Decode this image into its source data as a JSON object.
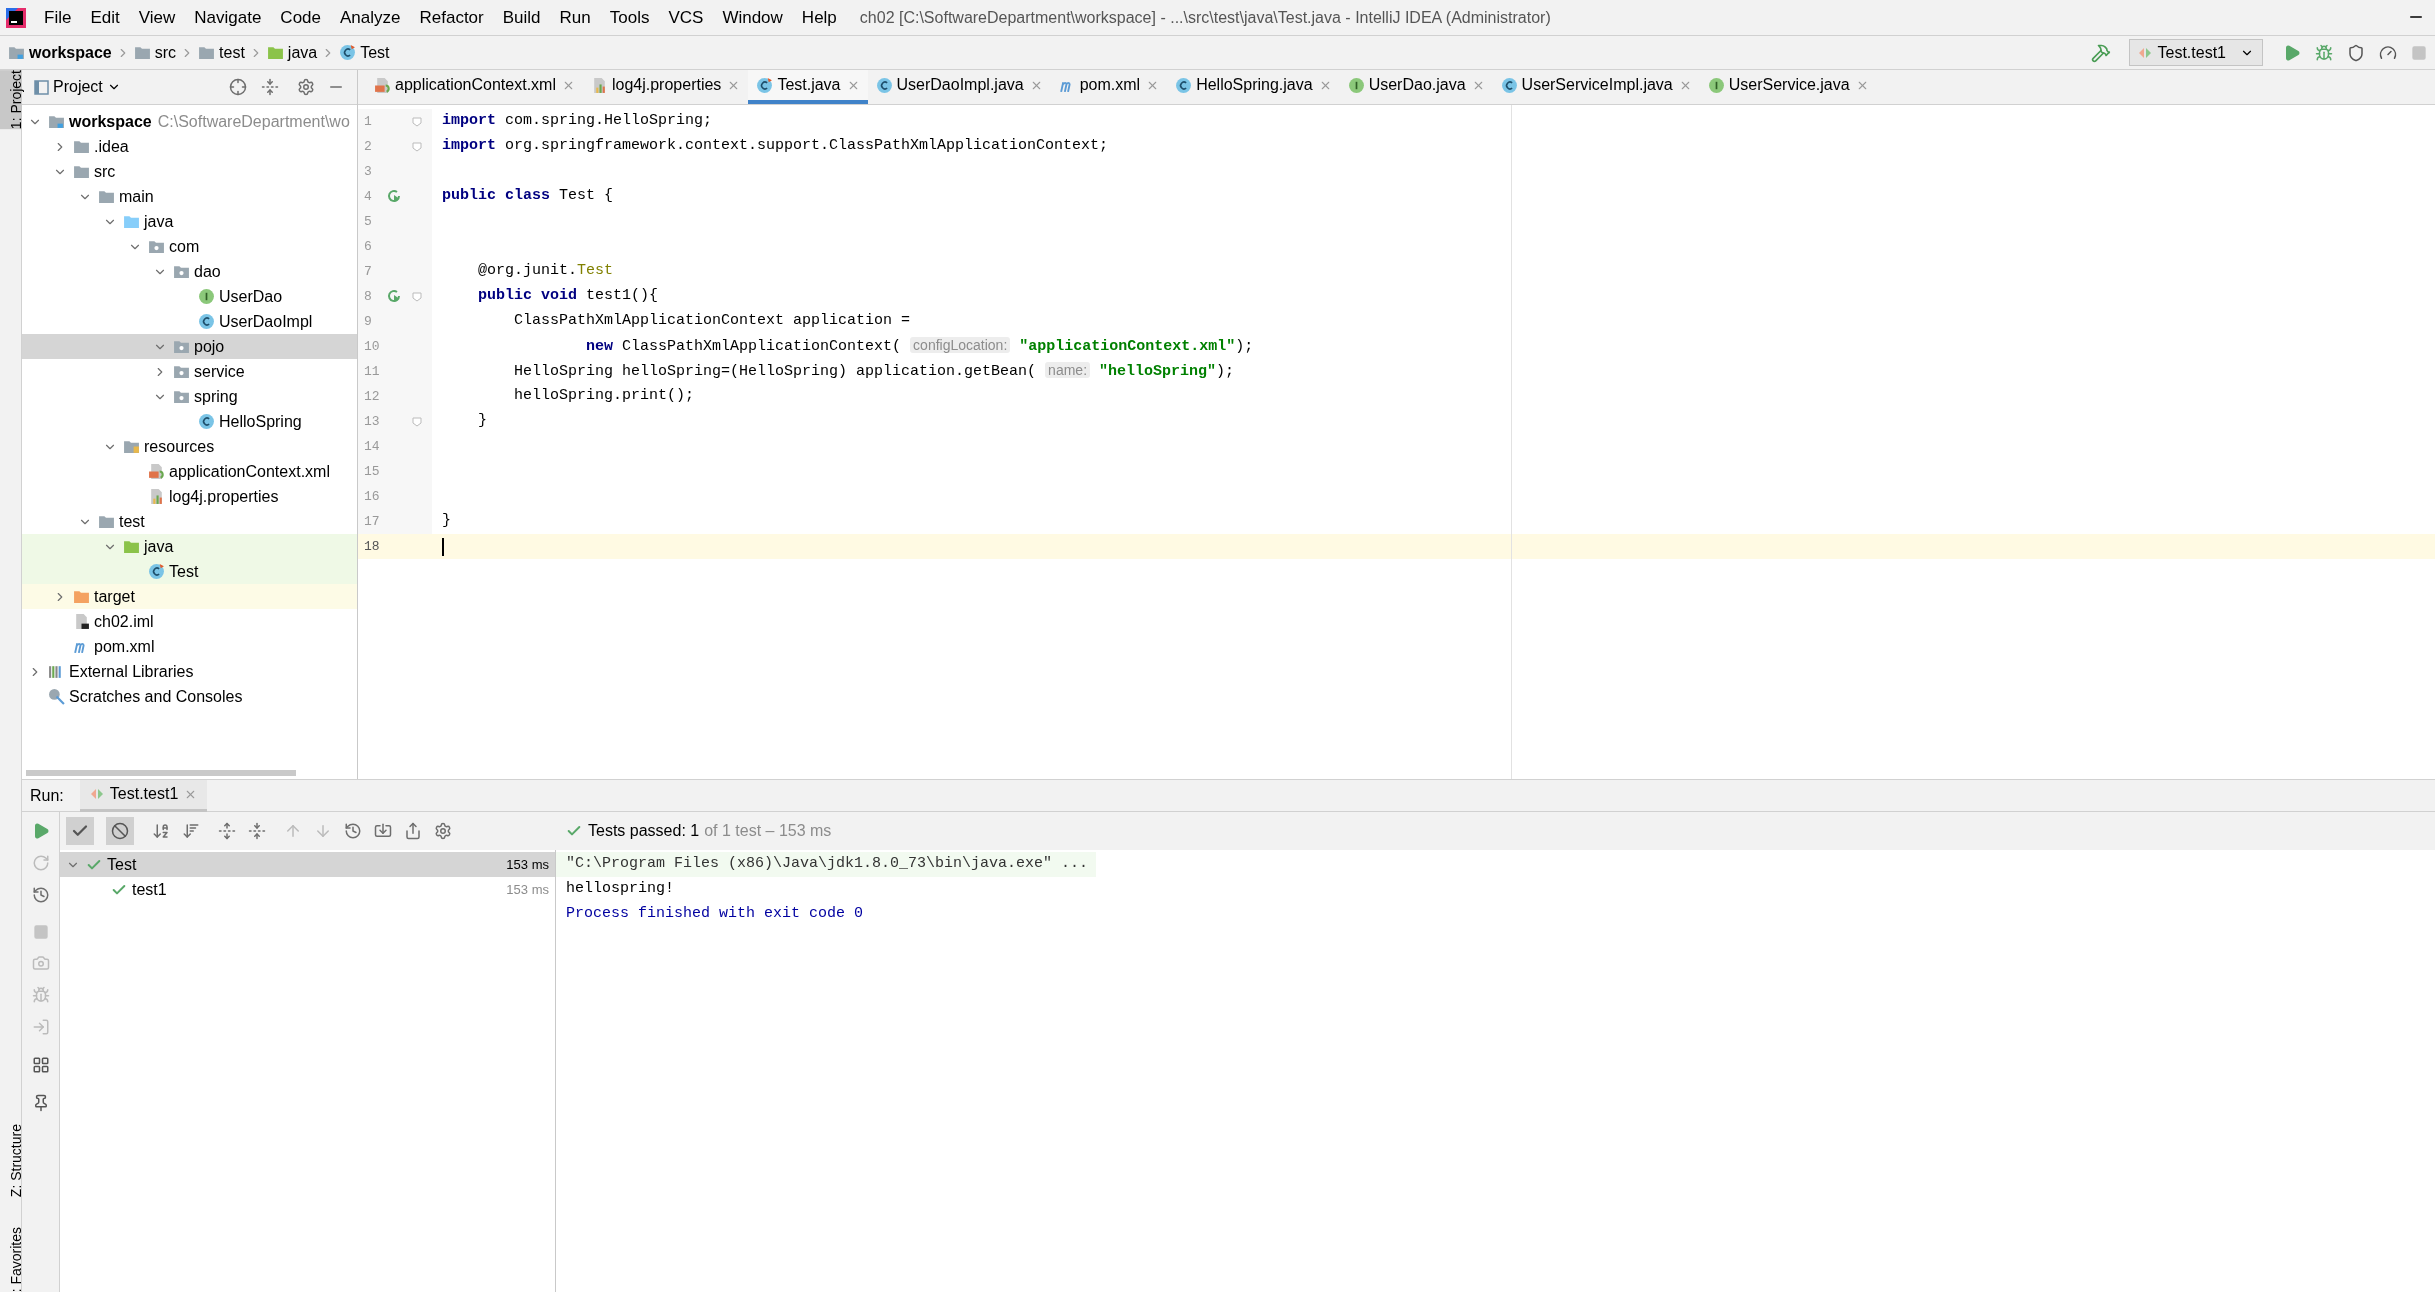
{
  "menu": [
    "File",
    "Edit",
    "View",
    "Navigate",
    "Code",
    "Analyze",
    "Refactor",
    "Build",
    "Run",
    "Tools",
    "VCS",
    "Window",
    "Help"
  ],
  "window": {
    "title": "ch02 [C:\\SoftwareDepartment\\workspace] - ...\\src\\test\\java\\Test.java - IntelliJ IDEA (Administrator)"
  },
  "breadcrumbs": [
    {
      "label": "workspace",
      "kind": "module"
    },
    {
      "label": "src",
      "kind": "folder"
    },
    {
      "label": "test",
      "kind": "folder"
    },
    {
      "label": "java",
      "kind": "test-folder"
    },
    {
      "label": "Test",
      "kind": "test-class"
    }
  ],
  "run_config": "Test.test1",
  "side_stripe": [
    {
      "label": "1: Project",
      "selected": true
    },
    {
      "label": "Z: Structure",
      "selected": false
    },
    {
      "label": ": Favorites",
      "selected": false
    }
  ],
  "project_panel": {
    "title": "Project",
    "tree": [
      {
        "label": "workspace",
        "path": "C:\\SoftwareDepartment\\wo",
        "kind": "module",
        "expanded": true,
        "selected": false,
        "children": [
          {
            "label": ".idea",
            "kind": "folder",
            "expanded": false,
            "selected": false
          },
          {
            "label": "src",
            "kind": "folder",
            "expanded": true,
            "selected": false,
            "children": [
              {
                "label": "main",
                "kind": "folder",
                "expanded": true,
                "selected": false,
                "children": [
                  {
                    "label": "java",
                    "kind": "source-folder",
                    "expanded": true,
                    "selected": false,
                    "children": [
                      {
                        "label": "com",
                        "kind": "package",
                        "expanded": true,
                        "selected": false,
                        "children": [
                          {
                            "label": "dao",
                            "kind": "package",
                            "expanded": true,
                            "selected": false,
                            "children": [
                              {
                                "label": "UserDao",
                                "kind": "interface",
                                "selected": false
                              },
                              {
                                "label": "UserDaoImpl",
                                "kind": "class",
                                "selected": false
                              }
                            ]
                          },
                          {
                            "label": "pojo",
                            "kind": "package",
                            "expanded": true,
                            "selected": true
                          },
                          {
                            "label": "service",
                            "kind": "package",
                            "expanded": false,
                            "selected": false
                          },
                          {
                            "label": "spring",
                            "kind": "package",
                            "expanded": true,
                            "selected": false,
                            "children": [
                              {
                                "label": "HelloSpring",
                                "kind": "class",
                                "selected": false
                              }
                            ]
                          }
                        ]
                      }
                    ]
                  },
                  {
                    "label": "resources",
                    "kind": "resources-folder",
                    "expanded": true,
                    "selected": false,
                    "children": [
                      {
                        "label": "applicationContext.xml",
                        "kind": "xml",
                        "selected": false
                      },
                      {
                        "label": "log4j.properties",
                        "kind": "properties",
                        "selected": false
                      }
                    ]
                  }
                ]
              },
              {
                "label": "test",
                "kind": "folder",
                "expanded": true,
                "selected": false,
                "children": [
                  {
                    "label": "java",
                    "kind": "test-folder",
                    "expanded": true,
                    "selected": false,
                    "children": [
                      {
                        "label": "Test",
                        "kind": "test-class",
                        "selected": false
                      }
                    ]
                  }
                ]
              }
            ]
          },
          {
            "label": "target",
            "kind": "excluded-folder",
            "expanded": false,
            "selected": false
          },
          {
            "label": "ch02.iml",
            "kind": "iml",
            "selected": false
          },
          {
            "label": "pom.xml",
            "kind": "maven",
            "selected": false
          }
        ]
      },
      {
        "label": "External Libraries",
        "kind": "libraries",
        "expanded": false,
        "selected": false
      },
      {
        "label": "Scratches and Consoles",
        "kind": "scratches",
        "selected": false
      }
    ]
  },
  "editor": {
    "tabs": [
      {
        "label": "applicationContext.xml",
        "kind": "xml",
        "selected": false
      },
      {
        "label": "log4j.properties",
        "kind": "properties",
        "selected": false
      },
      {
        "label": "Test.java",
        "kind": "test-class",
        "selected": true
      },
      {
        "label": "UserDaoImpl.java",
        "kind": "class",
        "selected": false
      },
      {
        "label": "pom.xml",
        "kind": "maven",
        "selected": false
      },
      {
        "label": "HelloSpring.java",
        "kind": "class",
        "selected": false
      },
      {
        "label": "UserDao.java",
        "kind": "interface",
        "selected": false
      },
      {
        "label": "UserServiceImpl.java",
        "kind": "class",
        "selected": false
      },
      {
        "label": "UserService.java",
        "kind": "interface",
        "selected": false
      }
    ],
    "lines": [
      {
        "number": "1",
        "run_marker": false,
        "fold_marker": true,
        "current": false,
        "tokens": [
          {
            "kind": "kw",
            "text": "import"
          },
          {
            "kind": "plain",
            "text": " com.spring.HelloSpring;"
          }
        ]
      },
      {
        "number": "2",
        "run_marker": false,
        "fold_marker": true,
        "current": false,
        "tokens": [
          {
            "kind": "kw",
            "text": "import"
          },
          {
            "kind": "plain",
            "text": " org.springframework.context.support.ClassPathXmlApplicationContext;"
          }
        ]
      },
      {
        "number": "3",
        "run_marker": false,
        "fold_marker": false,
        "current": false
      },
      {
        "number": "4",
        "run_marker": true,
        "fold_marker": false,
        "current": false,
        "tokens": [
          {
            "kind": "kw",
            "text": "public class"
          },
          {
            "kind": "plain",
            "text": " Test {"
          }
        ]
      },
      {
        "number": "5",
        "run_marker": false,
        "fold_marker": false,
        "current": false
      },
      {
        "number": "6",
        "run_marker": false,
        "fold_marker": false,
        "current": false
      },
      {
        "number": "7",
        "run_marker": false,
        "fold_marker": false,
        "current": false,
        "tokens": [
          {
            "kind": "plain",
            "text": "    @org.junit."
          },
          {
            "kind": "ann",
            "text": "Test"
          }
        ]
      },
      {
        "number": "8",
        "run_marker": true,
        "fold_marker": true,
        "current": false,
        "tokens": [
          {
            "kind": "kw",
            "text": "    public void"
          },
          {
            "kind": "plain",
            "text": " test1(){"
          }
        ]
      },
      {
        "number": "9",
        "run_marker": false,
        "fold_marker": false,
        "current": false,
        "tokens": [
          {
            "kind": "plain",
            "text": "        ClassPathXmlApplicationContext application ="
          }
        ]
      },
      {
        "number": "10",
        "run_marker": false,
        "fold_marker": false,
        "current": false,
        "tokens": [
          {
            "kind": "kw",
            "text": "                new"
          },
          {
            "kind": "plain",
            "text": " ClassPathXmlApplicationContext( "
          },
          {
            "kind": "hint",
            "text": "configLocation:"
          },
          {
            "kind": "str",
            "text": " \"applicationContext.xml\""
          },
          {
            "kind": "plain",
            "text": ");"
          }
        ]
      },
      {
        "number": "11",
        "run_marker": false,
        "fold_marker": false,
        "current": false,
        "tokens": [
          {
            "kind": "plain",
            "text": "        HelloSpring helloSpring=(HelloSpring) application.getBean( "
          },
          {
            "kind": "hint",
            "text": "name:"
          },
          {
            "kind": "str",
            "text": " \"helloSpring\""
          },
          {
            "kind": "plain",
            "text": ");"
          }
        ]
      },
      {
        "number": "12",
        "run_marker": false,
        "fold_marker": false,
        "current": false,
        "tokens": [
          {
            "kind": "plain",
            "text": "        helloSpring.print();"
          }
        ]
      },
      {
        "number": "13",
        "run_marker": false,
        "fold_marker": true,
        "current": false,
        "tokens": [
          {
            "kind": "plain",
            "text": "    }"
          }
        ]
      },
      {
        "number": "14",
        "run_marker": false,
        "fold_marker": false,
        "current": false
      },
      {
        "number": "15",
        "run_marker": false,
        "fold_marker": false,
        "current": false
      },
      {
        "number": "16",
        "run_marker": false,
        "fold_marker": false,
        "current": false
      },
      {
        "number": "17",
        "run_marker": false,
        "fold_marker": false,
        "current": false,
        "tokens": [
          {
            "kind": "plain",
            "text": "}"
          }
        ]
      },
      {
        "number": "18",
        "run_marker": false,
        "fold_marker": false,
        "current": true
      }
    ]
  },
  "run_panel": {
    "label": "Run:",
    "tab": "Test.test1",
    "filters": [
      {
        "kind": "passed",
        "on": true
      },
      {
        "kind": "ignored",
        "on": true
      }
    ],
    "status": "Tests passed: 1",
    "status_detail": "of 1 test – 153 ms",
    "tests": [
      {
        "label": "Test",
        "time": "153 ms",
        "selected": true,
        "expanded": true,
        "children": [
          {
            "label": "test1",
            "time": "153 ms",
            "selected": false
          }
        ]
      }
    ],
    "console": [
      {
        "kind": "command",
        "text": "\"C:\\Program Files (x86)\\Java\\jdk1.8.0_73\\bin\\java.exe\" ..."
      },
      {
        "kind": "output",
        "text": "hellospring!"
      },
      {
        "kind": "system",
        "text": "Process finished with exit code 0"
      }
    ]
  }
}
